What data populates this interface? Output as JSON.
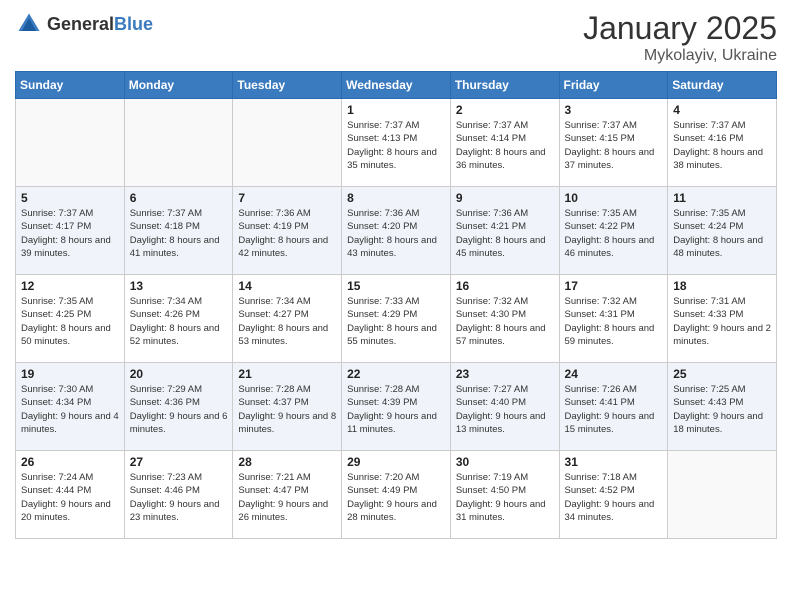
{
  "header": {
    "logo_general": "General",
    "logo_blue": "Blue",
    "month": "January 2025",
    "location": "Mykolayiv, Ukraine"
  },
  "days_of_week": [
    "Sunday",
    "Monday",
    "Tuesday",
    "Wednesday",
    "Thursday",
    "Friday",
    "Saturday"
  ],
  "weeks": [
    [
      {
        "day": "",
        "info": ""
      },
      {
        "day": "",
        "info": ""
      },
      {
        "day": "",
        "info": ""
      },
      {
        "day": "1",
        "info": "Sunrise: 7:37 AM\nSunset: 4:13 PM\nDaylight: 8 hours and 35 minutes."
      },
      {
        "day": "2",
        "info": "Sunrise: 7:37 AM\nSunset: 4:14 PM\nDaylight: 8 hours and 36 minutes."
      },
      {
        "day": "3",
        "info": "Sunrise: 7:37 AM\nSunset: 4:15 PM\nDaylight: 8 hours and 37 minutes."
      },
      {
        "day": "4",
        "info": "Sunrise: 7:37 AM\nSunset: 4:16 PM\nDaylight: 8 hours and 38 minutes."
      }
    ],
    [
      {
        "day": "5",
        "info": "Sunrise: 7:37 AM\nSunset: 4:17 PM\nDaylight: 8 hours and 39 minutes."
      },
      {
        "day": "6",
        "info": "Sunrise: 7:37 AM\nSunset: 4:18 PM\nDaylight: 8 hours and 41 minutes."
      },
      {
        "day": "7",
        "info": "Sunrise: 7:36 AM\nSunset: 4:19 PM\nDaylight: 8 hours and 42 minutes."
      },
      {
        "day": "8",
        "info": "Sunrise: 7:36 AM\nSunset: 4:20 PM\nDaylight: 8 hours and 43 minutes."
      },
      {
        "day": "9",
        "info": "Sunrise: 7:36 AM\nSunset: 4:21 PM\nDaylight: 8 hours and 45 minutes."
      },
      {
        "day": "10",
        "info": "Sunrise: 7:35 AM\nSunset: 4:22 PM\nDaylight: 8 hours and 46 minutes."
      },
      {
        "day": "11",
        "info": "Sunrise: 7:35 AM\nSunset: 4:24 PM\nDaylight: 8 hours and 48 minutes."
      }
    ],
    [
      {
        "day": "12",
        "info": "Sunrise: 7:35 AM\nSunset: 4:25 PM\nDaylight: 8 hours and 50 minutes."
      },
      {
        "day": "13",
        "info": "Sunrise: 7:34 AM\nSunset: 4:26 PM\nDaylight: 8 hours and 52 minutes."
      },
      {
        "day": "14",
        "info": "Sunrise: 7:34 AM\nSunset: 4:27 PM\nDaylight: 8 hours and 53 minutes."
      },
      {
        "day": "15",
        "info": "Sunrise: 7:33 AM\nSunset: 4:29 PM\nDaylight: 8 hours and 55 minutes."
      },
      {
        "day": "16",
        "info": "Sunrise: 7:32 AM\nSunset: 4:30 PM\nDaylight: 8 hours and 57 minutes."
      },
      {
        "day": "17",
        "info": "Sunrise: 7:32 AM\nSunset: 4:31 PM\nDaylight: 8 hours and 59 minutes."
      },
      {
        "day": "18",
        "info": "Sunrise: 7:31 AM\nSunset: 4:33 PM\nDaylight: 9 hours and 2 minutes."
      }
    ],
    [
      {
        "day": "19",
        "info": "Sunrise: 7:30 AM\nSunset: 4:34 PM\nDaylight: 9 hours and 4 minutes."
      },
      {
        "day": "20",
        "info": "Sunrise: 7:29 AM\nSunset: 4:36 PM\nDaylight: 9 hours and 6 minutes."
      },
      {
        "day": "21",
        "info": "Sunrise: 7:28 AM\nSunset: 4:37 PM\nDaylight: 9 hours and 8 minutes."
      },
      {
        "day": "22",
        "info": "Sunrise: 7:28 AM\nSunset: 4:39 PM\nDaylight: 9 hours and 11 minutes."
      },
      {
        "day": "23",
        "info": "Sunrise: 7:27 AM\nSunset: 4:40 PM\nDaylight: 9 hours and 13 minutes."
      },
      {
        "day": "24",
        "info": "Sunrise: 7:26 AM\nSunset: 4:41 PM\nDaylight: 9 hours and 15 minutes."
      },
      {
        "day": "25",
        "info": "Sunrise: 7:25 AM\nSunset: 4:43 PM\nDaylight: 9 hours and 18 minutes."
      }
    ],
    [
      {
        "day": "26",
        "info": "Sunrise: 7:24 AM\nSunset: 4:44 PM\nDaylight: 9 hours and 20 minutes."
      },
      {
        "day": "27",
        "info": "Sunrise: 7:23 AM\nSunset: 4:46 PM\nDaylight: 9 hours and 23 minutes."
      },
      {
        "day": "28",
        "info": "Sunrise: 7:21 AM\nSunset: 4:47 PM\nDaylight: 9 hours and 26 minutes."
      },
      {
        "day": "29",
        "info": "Sunrise: 7:20 AM\nSunset: 4:49 PM\nDaylight: 9 hours and 28 minutes."
      },
      {
        "day": "30",
        "info": "Sunrise: 7:19 AM\nSunset: 4:50 PM\nDaylight: 9 hours and 31 minutes."
      },
      {
        "day": "31",
        "info": "Sunrise: 7:18 AM\nSunset: 4:52 PM\nDaylight: 9 hours and 34 minutes."
      },
      {
        "day": "",
        "info": ""
      }
    ]
  ]
}
